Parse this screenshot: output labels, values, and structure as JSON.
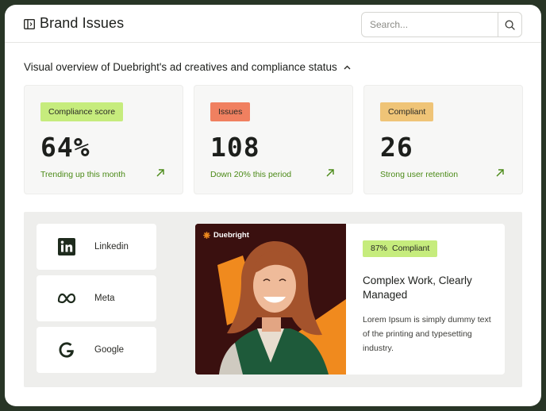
{
  "header": {
    "title": "Brand Issues",
    "search": {
      "placeholder": "Search...",
      "value": ""
    }
  },
  "overview": {
    "heading": "Visual overview of Duebright's ad creatives and compliance status",
    "stats": [
      {
        "badge": "Compliance score",
        "value": "64%",
        "note": "Trending up this month",
        "badge_color": "#c6ec7d"
      },
      {
        "badge": "Issues",
        "value": "108",
        "note": "Down 20% this period",
        "badge_color": "#f08060"
      },
      {
        "badge": "Compliant",
        "value": "26",
        "note": "Strong user retention",
        "badge_color": "#efc477"
      }
    ]
  },
  "platforms": [
    {
      "label": "Linkedin",
      "icon": "linkedin-icon"
    },
    {
      "label": "Meta",
      "icon": "meta-icon"
    },
    {
      "label": "Google",
      "icon": "google-icon"
    }
  ],
  "ad": {
    "brand": "Duebright",
    "compliance_pct": "87%",
    "compliance_label": "Compliant",
    "headline": "Complex Work, Clearly Managed",
    "body": "Lorem Ipsum is simply dummy text of the printing and typesetting industry."
  },
  "colors": {
    "frame": "#283526",
    "accent_green": "#4b8a17",
    "ad_orange": "#f08a1e",
    "ad_dark": "#3a100f"
  }
}
